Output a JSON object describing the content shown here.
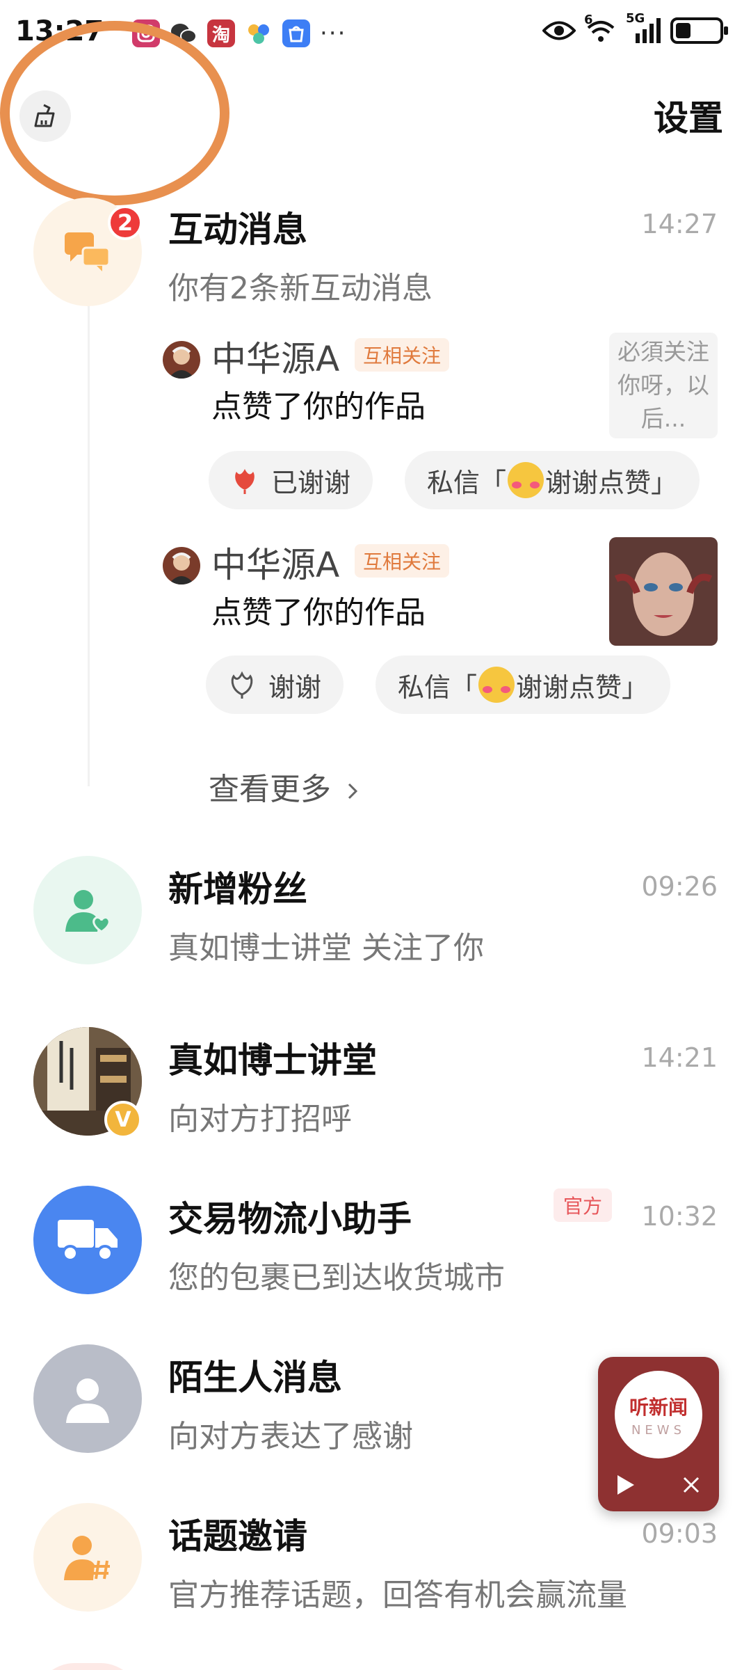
{
  "status_bar": {
    "time": "13:27",
    "network_label": "5G",
    "wifi_label": "6",
    "battery_level": 0.35,
    "apps": [
      {
        "name": "instagram-icon",
        "color": "#d13b6a",
        "glyph": ""
      },
      {
        "name": "wechat-icon",
        "color": "#3c3c3c",
        "glyph": ""
      },
      {
        "name": "taobao-icon",
        "color": "#c7353f",
        "glyph": "淘"
      },
      {
        "name": "pinwheel-icon",
        "color": "#ffffff",
        "glyph": ""
      },
      {
        "name": "shopping-bag-icon",
        "color": "#3d7ef5",
        "glyph": ""
      }
    ],
    "more": "···"
  },
  "header": {
    "settings_label": "设置"
  },
  "interaction": {
    "title": "互动消息",
    "time": "14:27",
    "subtitle": "你有2条新互动消息",
    "badge": "2",
    "items": [
      {
        "name": "中华源A",
        "tag": "互相关注",
        "text": "点赞了你的作品",
        "preview_text": "必須关注你呀，以后...",
        "thanks_label": "已谢谢",
        "dm_prefix": "私信「",
        "dm_text": "谢谢点赞」"
      },
      {
        "name": "中华源A",
        "tag": "互相关注",
        "text": "点赞了你的作品",
        "thanks_label": "谢谢",
        "dm_prefix": "私信「",
        "dm_text": "谢谢点赞」"
      }
    ],
    "see_more": "查看更多"
  },
  "conversations": [
    {
      "title": "新增粉丝",
      "subtitle": "真如博士讲堂 关注了你",
      "time": "09:26"
    },
    {
      "title": "真如博士讲堂",
      "subtitle": "向对方打招呼",
      "time": "14:21",
      "verified": "V"
    },
    {
      "title": "交易物流小助手",
      "subtitle": "您的包裹已到达收货城市",
      "time": "10:32",
      "tag": "官方"
    },
    {
      "title": "陌生人消息",
      "subtitle": "向对方表达了感谢",
      "time": ""
    },
    {
      "title": "话题邀请",
      "subtitle": "官方推荐话题，回答有机会赢流量",
      "time": "09:03"
    }
  ],
  "news_widget": {
    "title": "听新闻",
    "sub": "NEWS"
  },
  "colors": {
    "highlight_ring": "#e8904f",
    "interaction_bg": "#fdf3e6",
    "fans_bg": "#e9f7f0",
    "logistics_bg": "#4a86f0",
    "stranger_bg": "#b9bdc8",
    "topic_bg": "#fdf3e6"
  }
}
